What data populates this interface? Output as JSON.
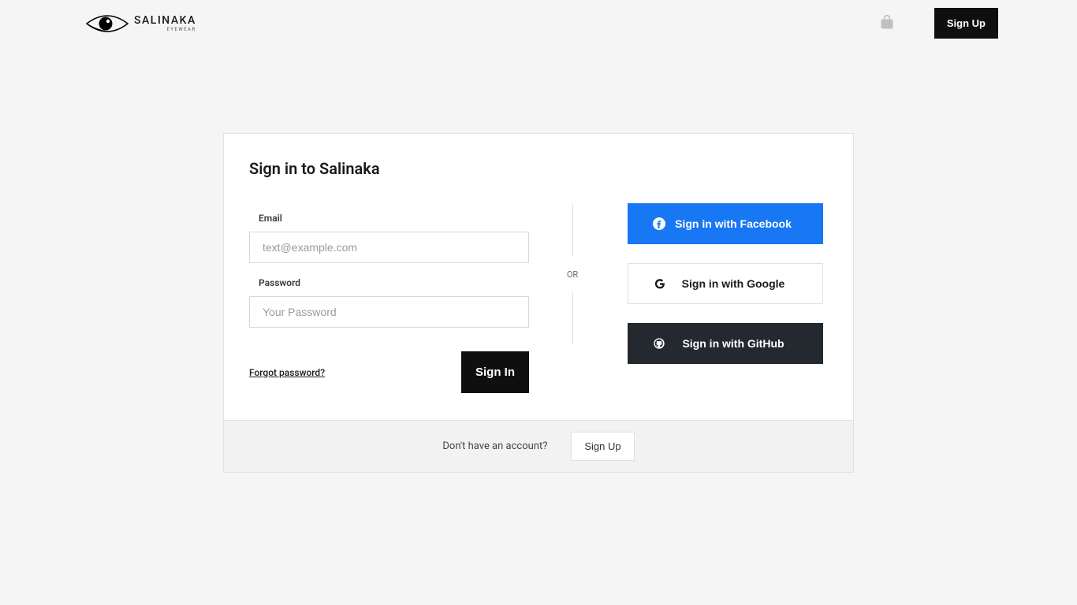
{
  "brand": {
    "name": "SALINAKA",
    "tagline": "EYEWEAR"
  },
  "header": {
    "signup": "Sign Up"
  },
  "signin": {
    "title": "Sign in to Salinaka",
    "email_label": "Email",
    "email_placeholder": "text@example.com",
    "password_label": "Password",
    "password_placeholder": "Your Password",
    "forgot": "Forgot password?",
    "submit": "Sign In",
    "or": "OR"
  },
  "social": {
    "facebook": "Sign in with Facebook",
    "google": "Sign in with Google",
    "github": "Sign in with GitHub"
  },
  "footer": {
    "prompt": "Don't have an account?",
    "signup": "Sign Up"
  }
}
